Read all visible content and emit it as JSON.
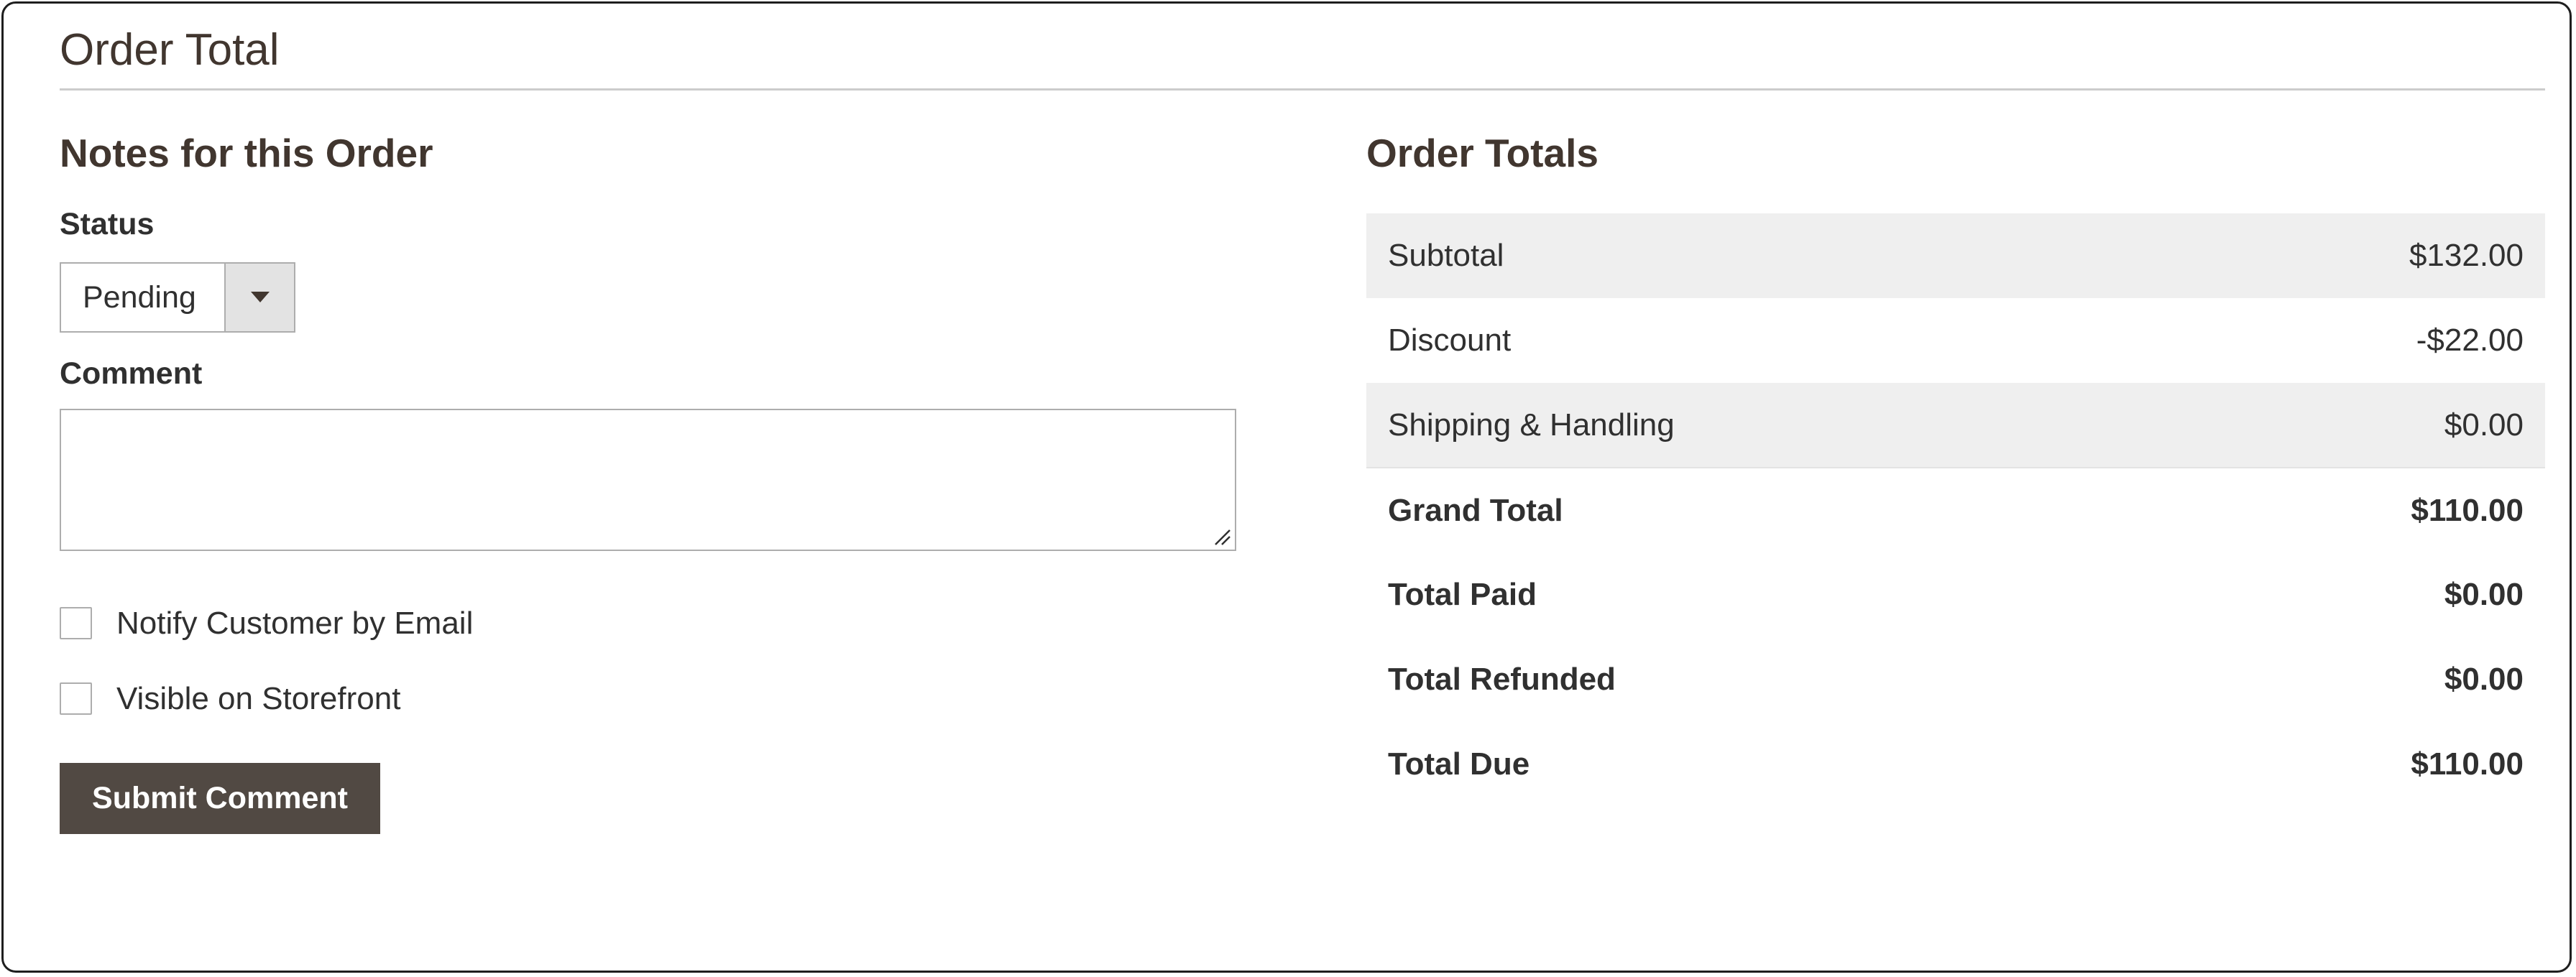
{
  "section": {
    "title": "Order Total"
  },
  "notes": {
    "title": "Notes for this Order",
    "status_label": "Status",
    "status_value": "Pending",
    "comment_label": "Comment",
    "comment_value": "",
    "notify_label": "Notify Customer by Email",
    "notify_checked": false,
    "visible_label": "Visible on Storefront",
    "visible_checked": false,
    "submit_label": "Submit Comment"
  },
  "totals": {
    "title": "Order Totals",
    "rows": [
      {
        "label": "Subtotal",
        "value": "$132.00"
      },
      {
        "label": "Discount",
        "value": "-$22.00"
      },
      {
        "label": "Shipping & Handling",
        "value": "$0.00"
      },
      {
        "label": "Grand Total",
        "value": "$110.00"
      },
      {
        "label": "Total Paid",
        "value": "$0.00"
      },
      {
        "label": "Total Refunded",
        "value": "$0.00"
      },
      {
        "label": "Total Due",
        "value": "$110.00"
      }
    ]
  },
  "colors": {
    "heading": "#41362f",
    "text": "#303030",
    "button_bg": "#514943",
    "row_shade": "#efefef",
    "border": "#adadad"
  },
  "icons": {
    "select_arrow": "caret-down-icon",
    "resize": "resize-grip-icon"
  }
}
